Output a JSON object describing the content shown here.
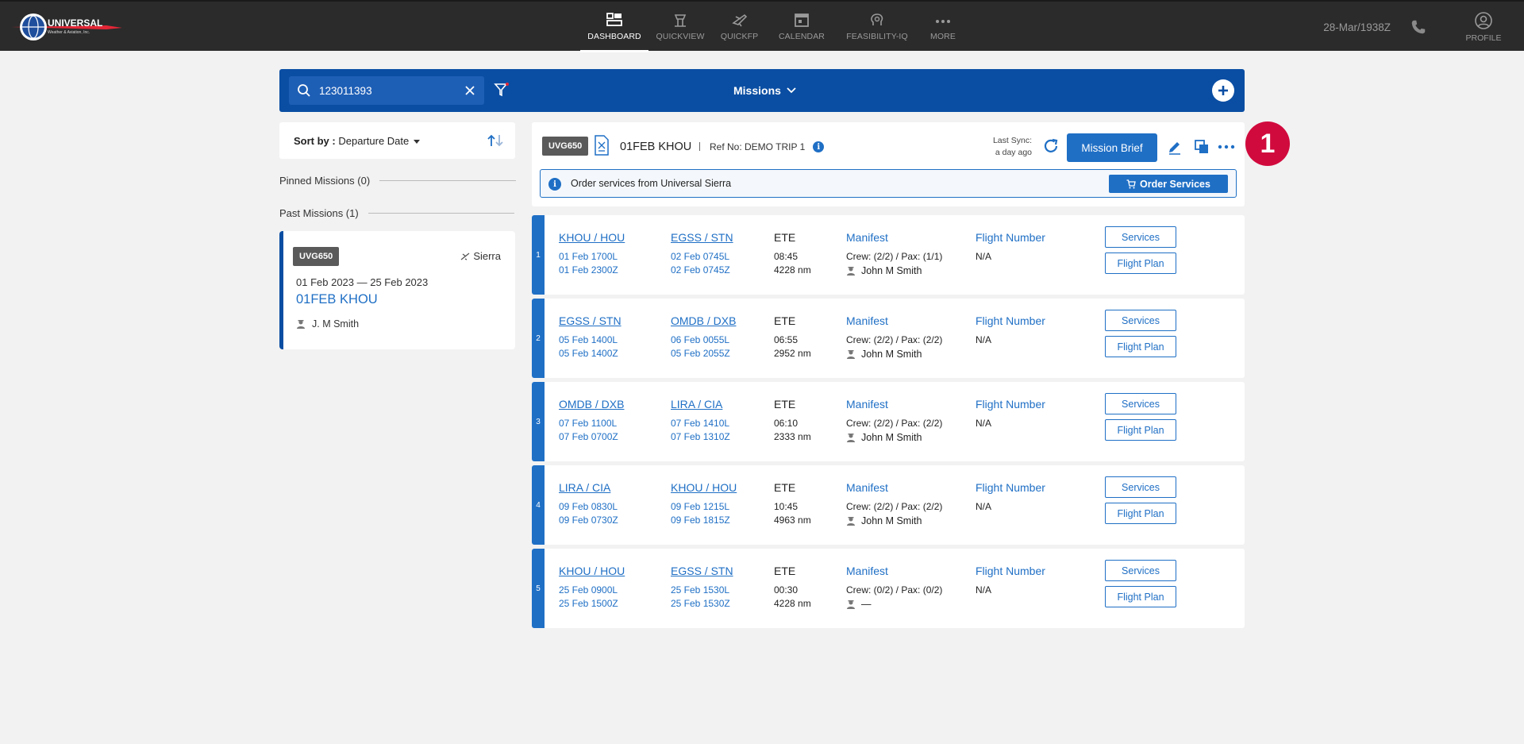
{
  "topbar": {
    "nav": [
      {
        "label": "DASHBOARD",
        "icon": "dashboard-icon",
        "active": true
      },
      {
        "label": "QUICKVIEW",
        "icon": "tower-icon"
      },
      {
        "label": "QUICKFP",
        "icon": "plane-icon"
      },
      {
        "label": "CALENDAR",
        "icon": "calendar-icon"
      },
      {
        "label": "FEASIBILITY-IQ",
        "icon": "brain-icon"
      },
      {
        "label": "MORE",
        "icon": "more-dots-icon"
      }
    ],
    "datetime": "28-Mar/1938Z",
    "profile_label": "PROFILE"
  },
  "search": {
    "value": "123011393",
    "missions_label": "Missions"
  },
  "sort": {
    "label": "Sort by :",
    "value": "Departure Date"
  },
  "sections": {
    "pinned": "Pinned Missions (0)",
    "past": "Past Missions (1)"
  },
  "mission_card": {
    "badge": "UVG650",
    "status": "Sierra",
    "dates": "01 Feb 2023 — 25 Feb 2023",
    "title": "01FEB KHOU",
    "pilot": "J. M Smith"
  },
  "header": {
    "badge": "UVG650",
    "title": "01FEB KHOU",
    "ref": "Ref No: DEMO TRIP 1",
    "sync_line1": "Last Sync:",
    "sync_line2": "a day ago",
    "brief_label": "Mission Brief",
    "order_text": "Order services from Universal Sierra",
    "order_label": "Order Services",
    "callout": "1"
  },
  "leg_labels": {
    "ete": "ETE",
    "manifest": "Manifest",
    "flight_number": "Flight Number",
    "services": "Services",
    "flight_plan": "Flight Plan"
  },
  "legs": [
    {
      "num": "1",
      "from": "KHOU / HOU",
      "from_local": "01 Feb 1700L",
      "from_zulu": "01 Feb 2300Z",
      "to": "EGSS / STN",
      "to_local": "02 Feb 0745L",
      "to_zulu": "02 Feb 0745Z",
      "ete": "08:45",
      "dist": "4228 nm",
      "crew": "Crew: (2/2) / Pax: (1/1)",
      "pilot": "John M Smith",
      "flight_number": "N/A"
    },
    {
      "num": "2",
      "from": "EGSS / STN",
      "from_local": "05 Feb 1400L",
      "from_zulu": "05 Feb 1400Z",
      "to": "OMDB / DXB",
      "to_local": "06 Feb 0055L",
      "to_zulu": "05 Feb 2055Z",
      "ete": "06:55",
      "dist": "2952 nm",
      "crew": "Crew: (2/2) / Pax: (2/2)",
      "pilot": "John M Smith",
      "flight_number": "N/A"
    },
    {
      "num": "3",
      "from": "OMDB / DXB",
      "from_local": "07 Feb 1100L",
      "from_zulu": "07 Feb 0700Z",
      "to": "LIRA / CIA",
      "to_local": "07 Feb 1410L",
      "to_zulu": "07 Feb 1310Z",
      "ete": "06:10",
      "dist": "2333 nm",
      "crew": "Crew: (2/2) / Pax: (2/2)",
      "pilot": "John M Smith",
      "flight_number": "N/A"
    },
    {
      "num": "4",
      "from": "LIRA / CIA",
      "from_local": "09 Feb 0830L",
      "from_zulu": "09 Feb 0730Z",
      "to": "KHOU / HOU",
      "to_local": "09 Feb 1215L",
      "to_zulu": "09 Feb 1815Z",
      "ete": "10:45",
      "dist": "4963 nm",
      "crew": "Crew: (2/2) / Pax: (2/2)",
      "pilot": "John M Smith",
      "flight_number": "N/A"
    },
    {
      "num": "5",
      "from": "KHOU / HOU",
      "from_local": "25 Feb 0900L",
      "from_zulu": "25 Feb 1500Z",
      "to": "EGSS / STN",
      "to_local": "25 Feb 1530L",
      "to_zulu": "25 Feb 1530Z",
      "ete": "00:30",
      "dist": "4228 nm",
      "crew": "Crew: (0/2) / Pax: (0/2)",
      "pilot": "—",
      "flight_number": "N/A"
    }
  ],
  "colors": {
    "topbar": "#2b2b2b",
    "brand_blue": "#0a4ea3",
    "link_blue": "#1f6fc5",
    "callout_red": "#d10a3d"
  }
}
